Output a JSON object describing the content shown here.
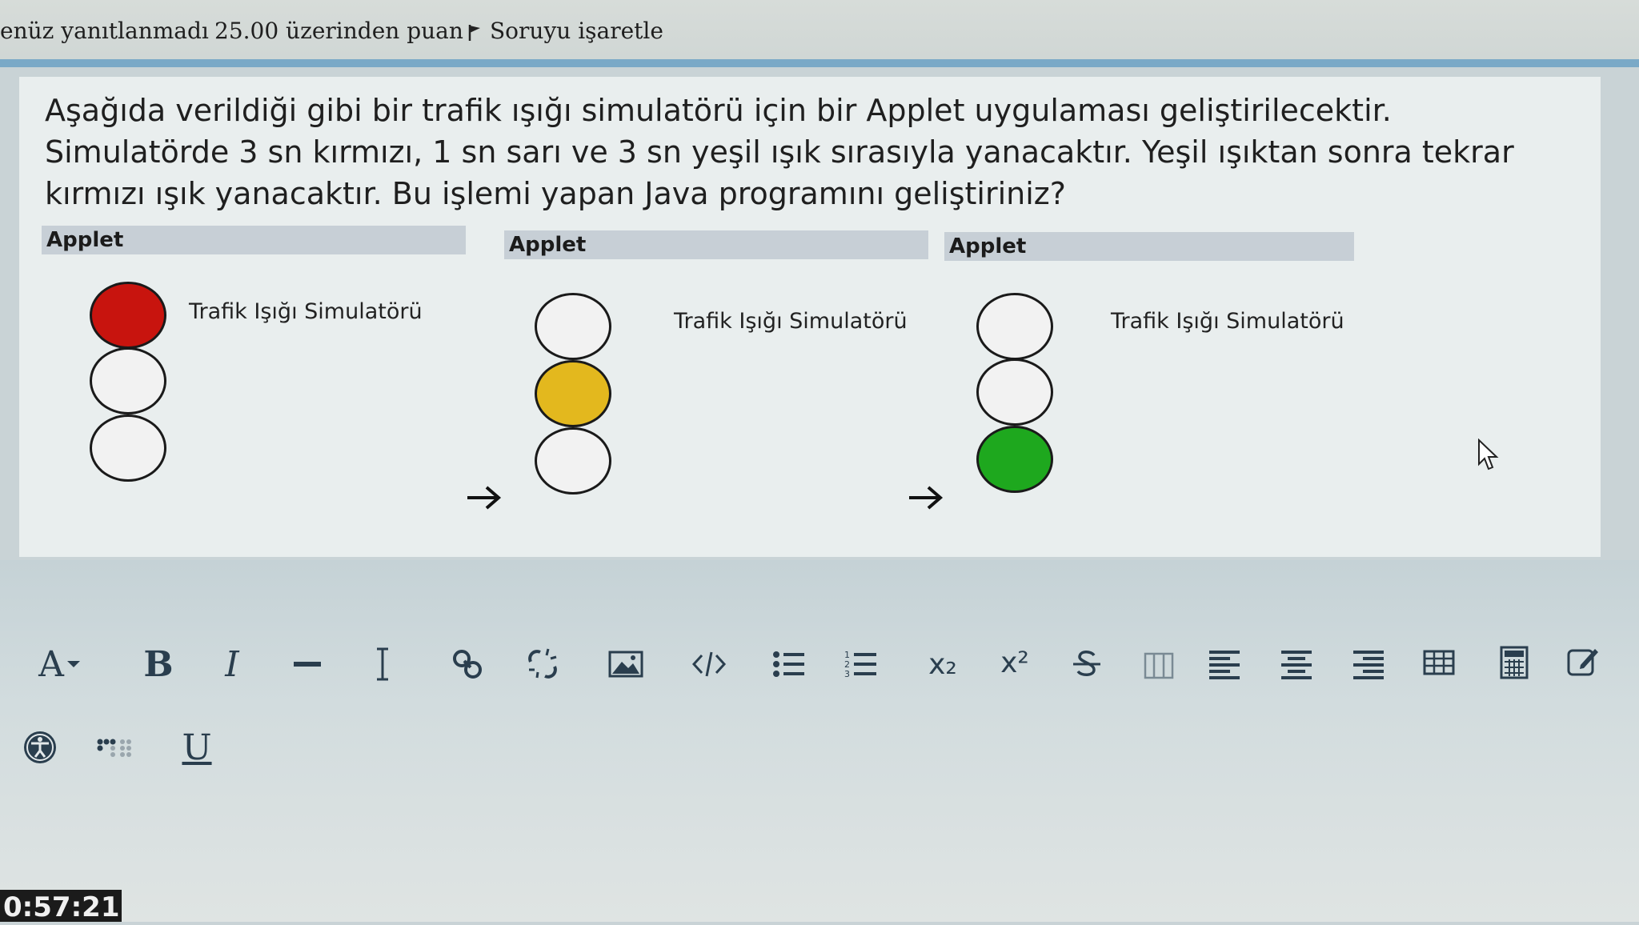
{
  "topbar": {
    "status": "enüz yanıtlanmadı",
    "points": "25.00 üzerinden puan",
    "flag_label": "Soruyu işaretle"
  },
  "question": {
    "text": "Aşağıda verildiği gibi bir trafik ışığı simulatörü için bir Applet uygulaması geliştirilecektir. Simulatörde 3 sn kırmızı, 1 sn sarı ve 3 sn yeşil ışık sırasıyla yanacaktır. Yeşil ışıktan sonra tekrar kırmızı ışık yanacaktır.  Bu işlemi yapan Java programını geliştiriniz?"
  },
  "applets": [
    {
      "header": "Applet",
      "title": "Trafik Işığı Simulatörü",
      "active": "red"
    },
    {
      "header": "Applet",
      "title": "Trafik Işığı Simulatörü",
      "active": "yellow"
    },
    {
      "header": "Applet",
      "title": "Trafik Işığı Simulatörü",
      "active": "green"
    }
  ],
  "colors": {
    "red": "#c8140e",
    "yellow": "#e3b81e",
    "green": "#1ea81e",
    "off": "#f2f2f2",
    "accent": "#7aa9c7"
  },
  "toolbar": {
    "font_label": "A",
    "bold": "B",
    "italic": "I",
    "subscript": "x₂",
    "superscript": "x²",
    "underline": "U"
  },
  "timer": "0:57:21"
}
